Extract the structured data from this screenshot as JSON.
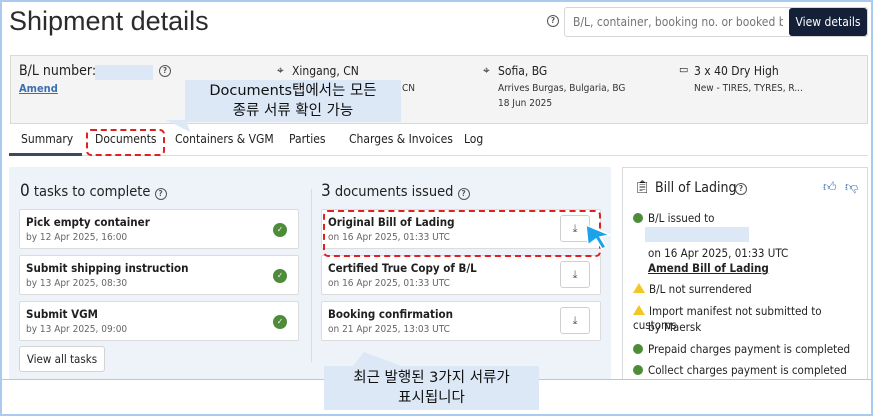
{
  "header": {
    "title": "Shipment details",
    "search_placeholder": "B/L, container, booking no. or booked by ref.",
    "view_details": "View details"
  },
  "summary": {
    "bl_label": "B/L number:",
    "amend": "Amend",
    "origin": "Xingang, CN",
    "origin_sub": "CN",
    "destination": "Sofia, BG",
    "arrives": "Arrives Burgas, Bulgaria, BG",
    "arrival_date": "18 Jun 2025",
    "containers": "3 x 40 Dry High",
    "commodity": "New - TIRES, TYRES, R..."
  },
  "tabs": [
    {
      "label": "Summary",
      "active": true
    },
    {
      "label": "Documents"
    },
    {
      "label": "Containers & VGM"
    },
    {
      "label": "Parties"
    },
    {
      "label": "Charges & Invoices"
    },
    {
      "label": "Log"
    }
  ],
  "tasks": {
    "count": "0",
    "title": " tasks to complete",
    "items": [
      {
        "title": "Pick empty container",
        "date": "by 12 Apr 2025, 16:00"
      },
      {
        "title": "Submit shipping instruction",
        "date": "by 13 Apr 2025, 08:30"
      },
      {
        "title": "Submit VGM",
        "date": "by 13 Apr 2025, 09:00"
      }
    ],
    "view_all": "View all tasks"
  },
  "documents": {
    "count": "3",
    "title": " documents issued",
    "items": [
      {
        "title": "Original Bill of Lading",
        "date": "on 16 Apr 2025, 01:33 UTC"
      },
      {
        "title": "Certified True Copy of B/L",
        "date": "on 16 Apr 2025, 01:33 UTC"
      },
      {
        "title": "Booking confirmation",
        "date": "on 21 Apr 2025, 13:03 UTC"
      }
    ]
  },
  "bol": {
    "title": "Bill of Lading",
    "issued": "B/L issued to",
    "issued_date": "on 16 Apr 2025, 01:33 UTC",
    "amend": "Amend Bill of Lading",
    "status": [
      {
        "text": "B/L not surrendered",
        "type": "warning"
      },
      {
        "text": "Import manifest not submitted to customs",
        "text2": "by Maersk",
        "type": "warning"
      },
      {
        "text": "Prepaid charges payment is completed",
        "type": "ok"
      },
      {
        "text": "Collect charges payment is completed",
        "type": "ok"
      }
    ]
  },
  "annotations": {
    "top_line1": "Documents탭에서는 모든",
    "top_line2": "종류 서류 확인 가능",
    "bottom_line1": "최근 발행된 3가지 서류가",
    "bottom_line2": "표시됩니다"
  },
  "colors": {
    "primary_dark": "#141f38",
    "link": "#3a6fb0",
    "success": "#4e8c3a",
    "warning": "#f3c623",
    "highlight": "#e02020",
    "callout": "#dce8f6"
  }
}
